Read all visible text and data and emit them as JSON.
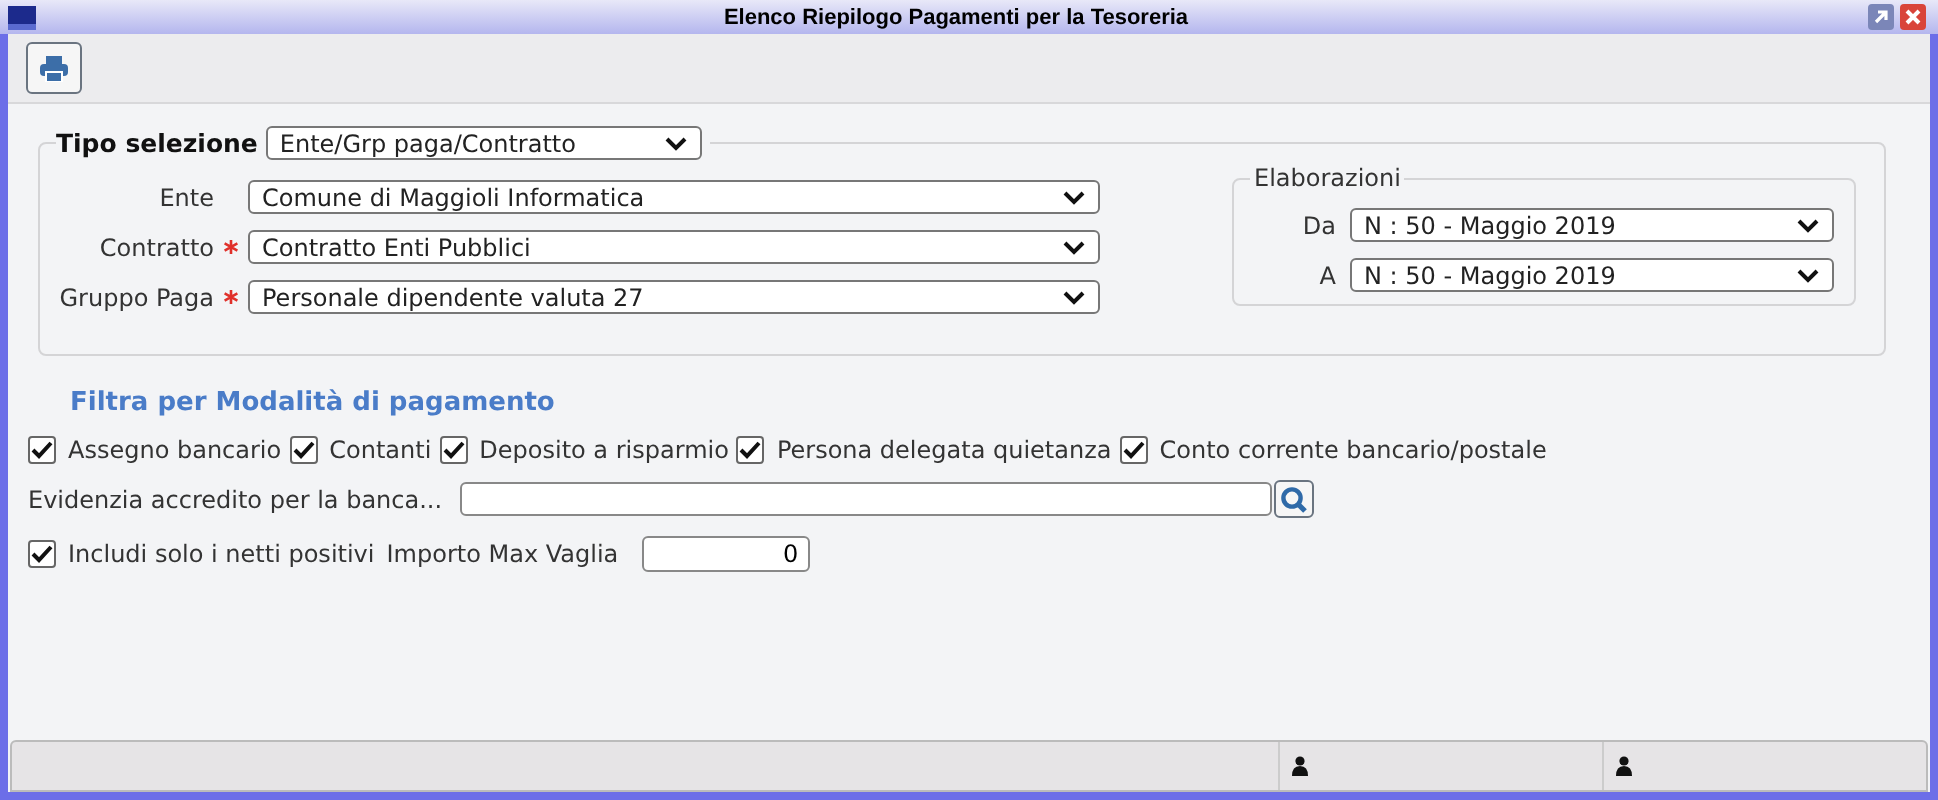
{
  "window": {
    "title": "Elenco Riepilogo Pagamenti per la Tesoreria"
  },
  "selection": {
    "label": "Tipo selezione",
    "value": "Ente/Grp paga/Contratto",
    "fields": [
      {
        "label": "Ente",
        "required": false,
        "value": "Comune di Maggioli Informatica"
      },
      {
        "label": "Contratto",
        "required": true,
        "value": "Contratto Enti Pubblici"
      },
      {
        "label": "Gruppo Paga",
        "required": true,
        "value": "Personale dipendente valuta 27"
      }
    ],
    "elaborazioni": {
      "title": "Elaborazioni",
      "fields": [
        {
          "label": "Da",
          "value": "N : 50 - Maggio 2019"
        },
        {
          "label": "A",
          "value": "N : 50 - Maggio 2019"
        }
      ]
    }
  },
  "filter": {
    "title": "Filtra per Modalità di pagamento",
    "methods": [
      {
        "label": "Assegno bancario",
        "checked": true
      },
      {
        "label": "Contanti",
        "checked": true
      },
      {
        "label": "Deposito a risparmio",
        "checked": true
      },
      {
        "label": "Persona delegata quietanza",
        "checked": true
      },
      {
        "label": "Conto corrente bancario/postale",
        "checked": true
      }
    ],
    "bank": {
      "label": "Evidenzia accredito per la banca..."
    },
    "positive": {
      "label": "Includi solo i netti positivi",
      "checked": true
    },
    "max": {
      "label": "Importo Max Vaglia",
      "value": "0"
    }
  }
}
